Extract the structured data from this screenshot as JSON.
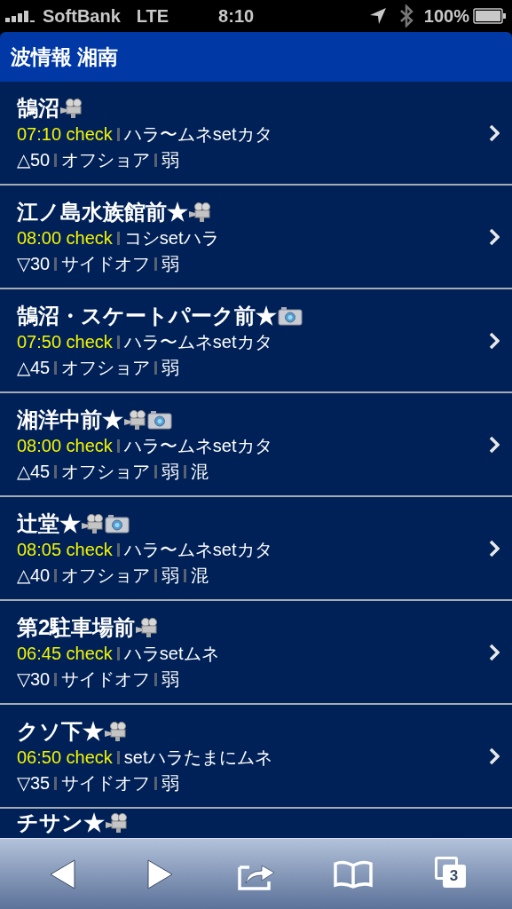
{
  "status_bar": {
    "carrier": "SoftBank",
    "network": "LTE",
    "time": "8:10",
    "battery": "100%"
  },
  "header": {
    "title": "波情報 湘南"
  },
  "spots": [
    {
      "name": "鵠沼",
      "media": [
        {
          "kind": "video"
        }
      ],
      "time": "07:10 check",
      "setting": "ハラ〜ムネsetカタ",
      "details": [
        "△50",
        "オフショア",
        "弱"
      ]
    },
    {
      "name": "江ノ島水族館前★",
      "media": [
        {
          "kind": "video"
        }
      ],
      "time": "08:00 check",
      "setting": "コシsetハラ",
      "details": [
        "▽30",
        "サイドオフ",
        "弱"
      ]
    },
    {
      "name": "鵠沼・スケートパーク前★",
      "media": [
        {
          "kind": "camera"
        }
      ],
      "time": "07:50 check",
      "setting": "ハラ〜ムネsetカタ",
      "details": [
        "△45",
        "オフショア",
        "弱"
      ]
    },
    {
      "name": "湘洋中前★",
      "media": [
        {
          "kind": "video"
        },
        {
          "kind": "camera"
        }
      ],
      "time": "08:00 check",
      "setting": "ハラ〜ムネsetカタ",
      "details": [
        "△45",
        "オフショア",
        "弱",
        "混"
      ]
    },
    {
      "name": "辻堂★",
      "media": [
        {
          "kind": "video"
        },
        {
          "kind": "camera"
        }
      ],
      "time": "08:05 check",
      "setting": "ハラ〜ムネsetカタ",
      "details": [
        "△40",
        "オフショア",
        "弱",
        "混"
      ]
    },
    {
      "name": "第2駐車場前",
      "media": [
        {
          "kind": "video"
        }
      ],
      "time": "06:45 check",
      "setting": "ハラsetムネ",
      "details": [
        "▽30",
        "サイドオフ",
        "弱"
      ]
    },
    {
      "name": "クソ下★",
      "media": [
        {
          "kind": "video"
        }
      ],
      "time": "06:50 check",
      "setting": "setハラたまにムネ",
      "details": [
        "▽35",
        "サイドオフ",
        "弱"
      ]
    },
    {
      "name": "チサン★",
      "media": [
        {
          "kind": "video"
        }
      ]
    }
  ],
  "toolbar": {
    "tab_count": "3"
  }
}
